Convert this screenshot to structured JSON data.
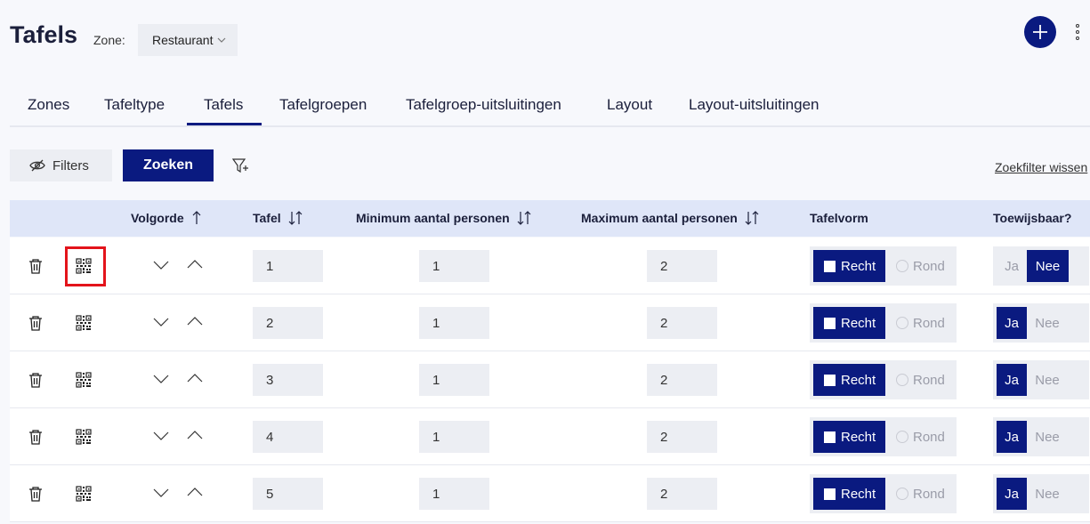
{
  "page": {
    "title": "Tafels",
    "zone_label": "Zone:",
    "zone_value": "Restaurant"
  },
  "tabs": [
    {
      "label": "Zones"
    },
    {
      "label": "Tafeltype"
    },
    {
      "label": "Tafels",
      "active": true
    },
    {
      "label": "Tafelgroepen"
    },
    {
      "label": "Tafelgroep-uitsluitingen"
    },
    {
      "label": "Layout"
    },
    {
      "label": "Layout-uitsluitingen"
    }
  ],
  "toolbar": {
    "filters_label": "Filters",
    "search_label": "Zoeken",
    "clear_label": "Zoekfilter wissen"
  },
  "columns": {
    "order": "Volgorde",
    "table": "Tafel",
    "min": "Minimum aantal personen",
    "max": "Maximum aantal personen",
    "shape": "Tafelvorm",
    "assignable": "Toewijsbaar?"
  },
  "options": {
    "shape_square": "Recht",
    "shape_round": "Rond",
    "yes": "Ja",
    "no": "Nee"
  },
  "rows": [
    {
      "tafel": "1",
      "min": "1",
      "max": "2",
      "shape": "Recht",
      "assignable": "Nee"
    },
    {
      "tafel": "2",
      "min": "1",
      "max": "2",
      "shape": "Recht",
      "assignable": "Ja"
    },
    {
      "tafel": "3",
      "min": "1",
      "max": "2",
      "shape": "Recht",
      "assignable": "Ja"
    },
    {
      "tafel": "4",
      "min": "1",
      "max": "2",
      "shape": "Recht",
      "assignable": "Ja"
    },
    {
      "tafel": "5",
      "min": "1",
      "max": "2",
      "shape": "Recht",
      "assignable": "Ja"
    }
  ],
  "colors": {
    "primary": "#0a1a80",
    "header_bg": "#dfe6f8",
    "highlight": "#e3141b"
  }
}
